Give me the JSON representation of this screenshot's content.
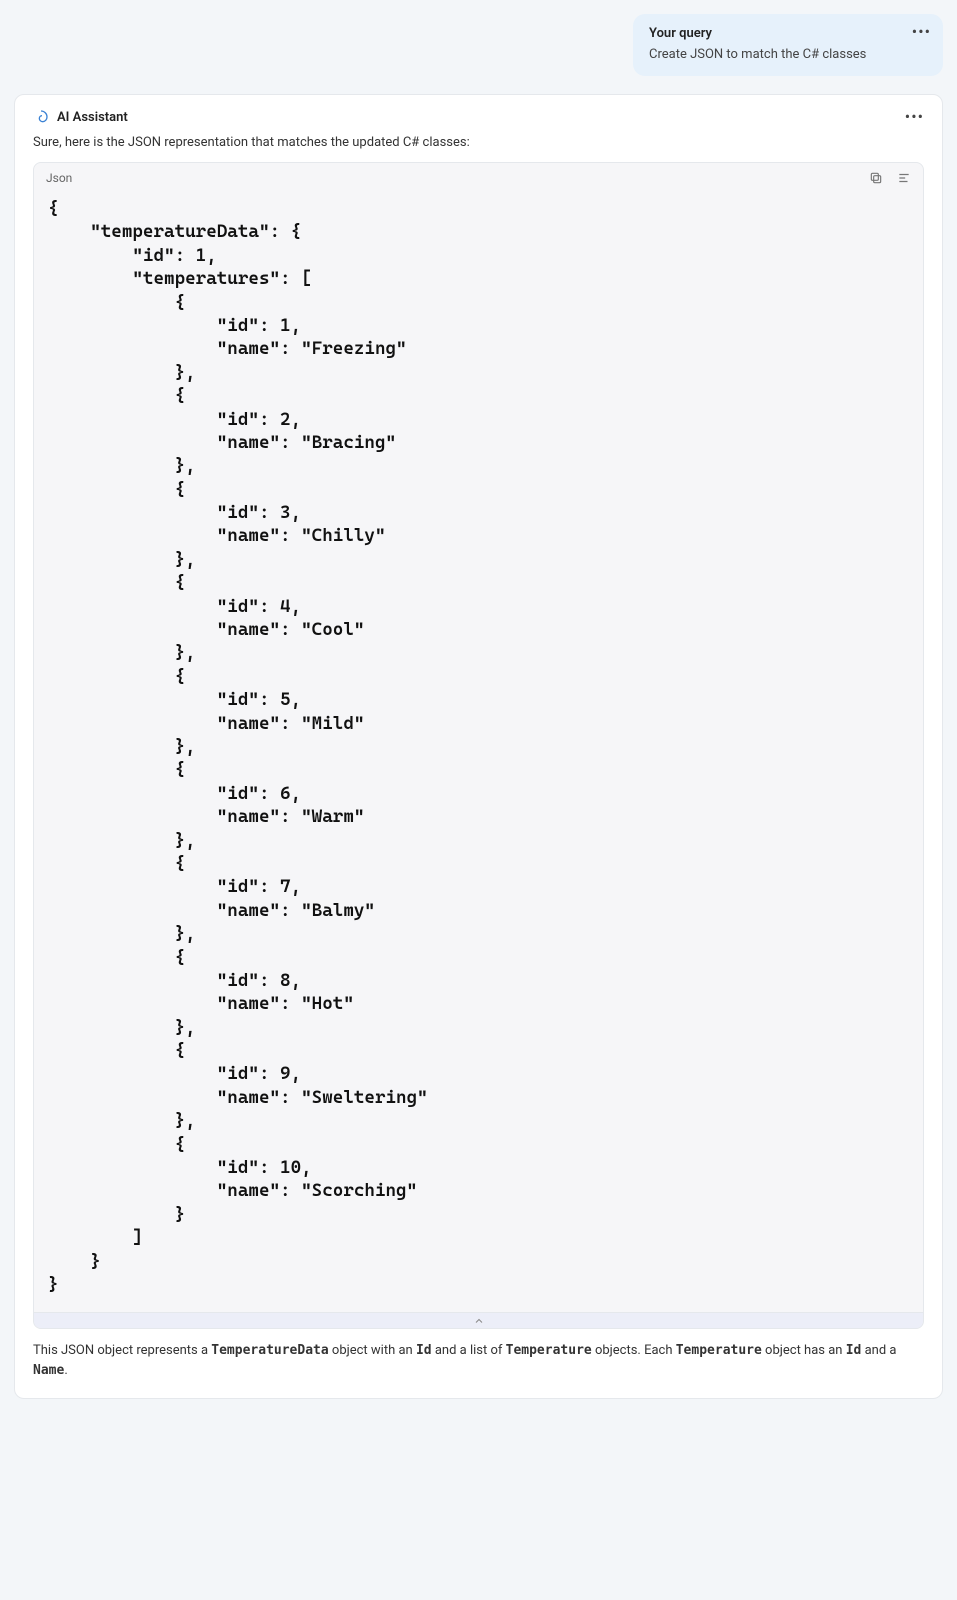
{
  "user_query": {
    "title": "Your query",
    "text": "Create JSON to match the C# classes"
  },
  "assistant": {
    "name": "AI Assistant",
    "intro": "Sure, here is the JSON representation that matches the updated C# classes:"
  },
  "code_block": {
    "language_label": "Json",
    "content": "{\n    \"temperatureData\": {\n        \"id\": 1,\n        \"temperatures\": [\n            {\n                \"id\": 1,\n                \"name\": \"Freezing\"\n            },\n            {\n                \"id\": 2,\n                \"name\": \"Bracing\"\n            },\n            {\n                \"id\": 3,\n                \"name\": \"Chilly\"\n            },\n            {\n                \"id\": 4,\n                \"name\": \"Cool\"\n            },\n            {\n                \"id\": 5,\n                \"name\": \"Mild\"\n            },\n            {\n                \"id\": 6,\n                \"name\": \"Warm\"\n            },\n            {\n                \"id\": 7,\n                \"name\": \"Balmy\"\n            },\n            {\n                \"id\": 8,\n                \"name\": \"Hot\"\n            },\n            {\n                \"id\": 9,\n                \"name\": \"Sweltering\"\n            },\n            {\n                \"id\": 10,\n                \"name\": \"Scorching\"\n            }\n        ]\n    }\n}"
  },
  "explanation": {
    "prefix": "This JSON object represents a ",
    "t1": "TemperatureData",
    "mid1": " object with an ",
    "t2": "Id",
    "mid2": " and a list of ",
    "t3": "Temperature",
    "mid3": " objects. Each ",
    "t4": "Temperature",
    "mid4": " object has an ",
    "t5": "Id",
    "mid5": " and a ",
    "t6": "Name",
    "suffix": "."
  }
}
